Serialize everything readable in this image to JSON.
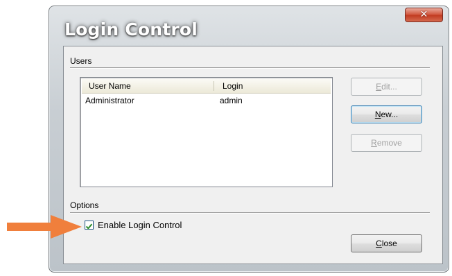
{
  "window": {
    "title": "Login Control",
    "close_glyph": "✕"
  },
  "users_group": {
    "label": "Users",
    "columns": [
      "User Name",
      "Login"
    ],
    "rows": [
      {
        "user_name": "Administrator",
        "login": "admin"
      }
    ]
  },
  "buttons": {
    "edit": {
      "label": "Edit...",
      "accel": "E",
      "rest": "dit...",
      "enabled": false
    },
    "new": {
      "label": "New...",
      "accel": "N",
      "rest": "ew...",
      "enabled": true
    },
    "remove": {
      "label": "Remove",
      "accel": "R",
      "rest": "emove",
      "enabled": false
    },
    "close": {
      "label": "Close",
      "accel": "C",
      "rest": "lose",
      "enabled": true
    }
  },
  "options_group": {
    "label": "Options",
    "enable_login_control": {
      "label": "Enable Login Control",
      "checked": true
    }
  },
  "annotation": {
    "icon": "arrow-right-icon",
    "color": "#f07f3c"
  }
}
